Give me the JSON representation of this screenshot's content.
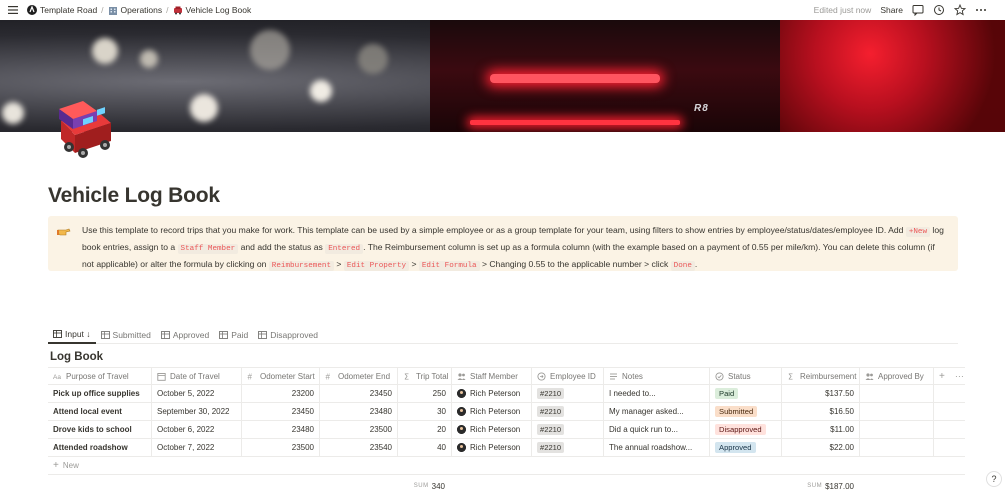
{
  "topbar": {
    "breadcrumbs": [
      {
        "label": "Template Road",
        "icon": "template-road-logo-icon"
      },
      {
        "label": "Operations",
        "icon": "building-icon"
      },
      {
        "label": "Vehicle Log Book",
        "icon": "car-icon"
      }
    ],
    "edited": "Edited just now",
    "share": "Share"
  },
  "page": {
    "title": "Vehicle Log Book",
    "icon": "truck-icon"
  },
  "callout": {
    "icon": "pointing-hand-icon",
    "t1": "Use this template to record trips that you make for work. This template can be used by a simple employee or as a group template for your team, using filters to show entries by employee/status/dates/employee ID. Add ",
    "c1": "+New",
    "t2": " log book entries, assign to a ",
    "c2": "Staff Member",
    "t3": " and add the status as ",
    "c3": "Entered",
    "t4": ". The Reimbursement column is set up as a formula column (with the example based on a payment of 0.55 per mile/km). You can delete this column (if not applicable) or alter the formula by clicking on ",
    "c4": "Reimbursement",
    "t5": " > ",
    "c5": "Edit Property",
    "t6": " > ",
    "c6": "Edit Formula",
    "t7": " > Changing 0.55 to the applicable number > click ",
    "c7": "Done",
    "t8": "."
  },
  "tabs": [
    {
      "label": "Input ↓",
      "active": true
    },
    {
      "label": "Submitted",
      "active": false
    },
    {
      "label": "Approved",
      "active": false
    },
    {
      "label": "Paid",
      "active": false
    },
    {
      "label": "Disapproved",
      "active": false
    }
  ],
  "database": {
    "title": "Log Book",
    "columns": [
      {
        "label": "Purpose of Travel",
        "icon": "text-icon"
      },
      {
        "label": "Date of Travel",
        "icon": "calendar-icon"
      },
      {
        "label": "Odometer Start",
        "icon": "number-icon"
      },
      {
        "label": "Odometer End",
        "icon": "number-icon"
      },
      {
        "label": "Trip Total",
        "icon": "sigma-icon"
      },
      {
        "label": "Staff Member",
        "icon": "people-icon"
      },
      {
        "label": "Employee ID",
        "icon": "rollup-icon"
      },
      {
        "label": "Notes",
        "icon": "lines-icon"
      },
      {
        "label": "Status",
        "icon": "status-icon"
      },
      {
        "label": "Reimbursement",
        "icon": "sigma-icon"
      },
      {
        "label": "Approved By",
        "icon": "people-icon"
      }
    ],
    "rows": [
      {
        "purpose": "Pick up office supplies",
        "date": "October 5, 2022",
        "start": "23200",
        "end": "23450",
        "total": "250",
        "staff": "Rich Peterson",
        "empid": "#2210",
        "notes": "I needed to...",
        "status": "Paid",
        "reimb": "$137.50"
      },
      {
        "purpose": "Attend local event",
        "date": "September 30, 2022",
        "start": "23450",
        "end": "23480",
        "total": "30",
        "staff": "Rich Peterson",
        "empid": "#2210",
        "notes": "My manager asked...",
        "status": "Submitted",
        "reimb": "$16.50"
      },
      {
        "purpose": "Drove kids to school",
        "date": "October 6, 2022",
        "start": "23480",
        "end": "23500",
        "total": "20",
        "staff": "Rich Peterson",
        "empid": "#2210",
        "notes": "Did a quick run to...",
        "status": "Disapproved",
        "reimb": "$11.00"
      },
      {
        "purpose": "Attended roadshow",
        "date": "October 7, 2022",
        "start": "23500",
        "end": "23540",
        "total": "40",
        "staff": "Rich Peterson",
        "empid": "#2210",
        "notes": "The annual roadshow...",
        "status": "Approved",
        "reimb": "$22.00"
      }
    ],
    "new_label": "New",
    "sum_label": "SUM",
    "sum_trip_total": "340",
    "sum_reimbursement": "$187.00"
  },
  "status_colors": {
    "Paid": {
      "bg": "#dbeddb",
      "fg": "#1c3829"
    },
    "Submitted": {
      "bg": "#fadec9",
      "fg": "#49290e"
    },
    "Disapproved": {
      "bg": "#ffe2dd",
      "fg": "#5d1715"
    },
    "Approved": {
      "bg": "#d3e5ef",
      "fg": "#183347"
    }
  },
  "help": "?"
}
